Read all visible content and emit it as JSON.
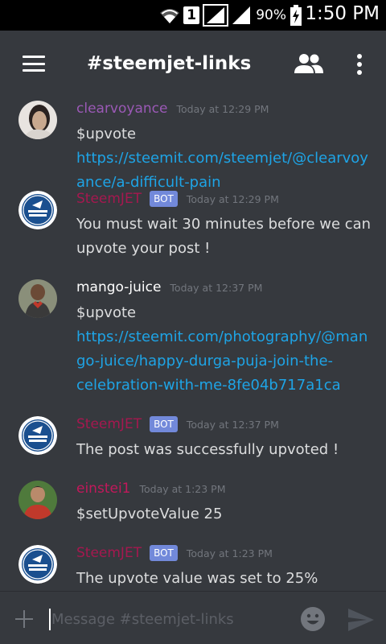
{
  "status_bar": {
    "battery_percent": "90%",
    "time": "1:50 PM",
    "sim_slot": "1"
  },
  "channel": {
    "title": "#steemjet-links"
  },
  "messages": [
    {
      "author": "clearvoyance",
      "author_color": "#9b59b6",
      "timestamp": "Today at 12:29 PM",
      "is_bot": false,
      "bot_label": "",
      "text": "$upvote ",
      "link": "https://steemit.com/steemjet/@clearvoyance/a-difficult-pain"
    },
    {
      "author": "SteemJET",
      "author_color": "#a5184f",
      "timestamp": "Today at 12:29 PM",
      "is_bot": true,
      "bot_label": "BOT",
      "text": "You must wait 30 minutes before we can upvote your post !",
      "link": ""
    },
    {
      "author": "mango-juice",
      "author_color": "#ffffff",
      "timestamp": "Today at 12:37 PM",
      "is_bot": false,
      "bot_label": "",
      "text": "$upvote ",
      "link": "https://steemit.com/photography/@mango-juice/happy-durga-puja-join-the-celebration-with-me-8fe04b717a1ca"
    },
    {
      "author": "SteemJET",
      "author_color": "#a5184f",
      "timestamp": "Today at 12:37 PM",
      "is_bot": true,
      "bot_label": "BOT",
      "text": "The post was successfully upvoted !",
      "link": ""
    },
    {
      "author": "einstei1",
      "author_color": "#c2185b",
      "timestamp": "Today at 1:23 PM",
      "is_bot": false,
      "bot_label": "",
      "text": "$setUpvoteValue 25",
      "link": ""
    },
    {
      "author": "SteemJET",
      "author_color": "#a5184f",
      "timestamp": "Today at 1:23 PM",
      "is_bot": true,
      "bot_label": "BOT",
      "text": "The upvote value was set to 25%",
      "link": ""
    }
  ],
  "composer": {
    "placeholder": "Message #steemjet-links"
  },
  "colors": {
    "background": "#36393e",
    "link": "#1ea4e6",
    "bot_badge": "#7289da",
    "timestamp": "#72767d"
  }
}
